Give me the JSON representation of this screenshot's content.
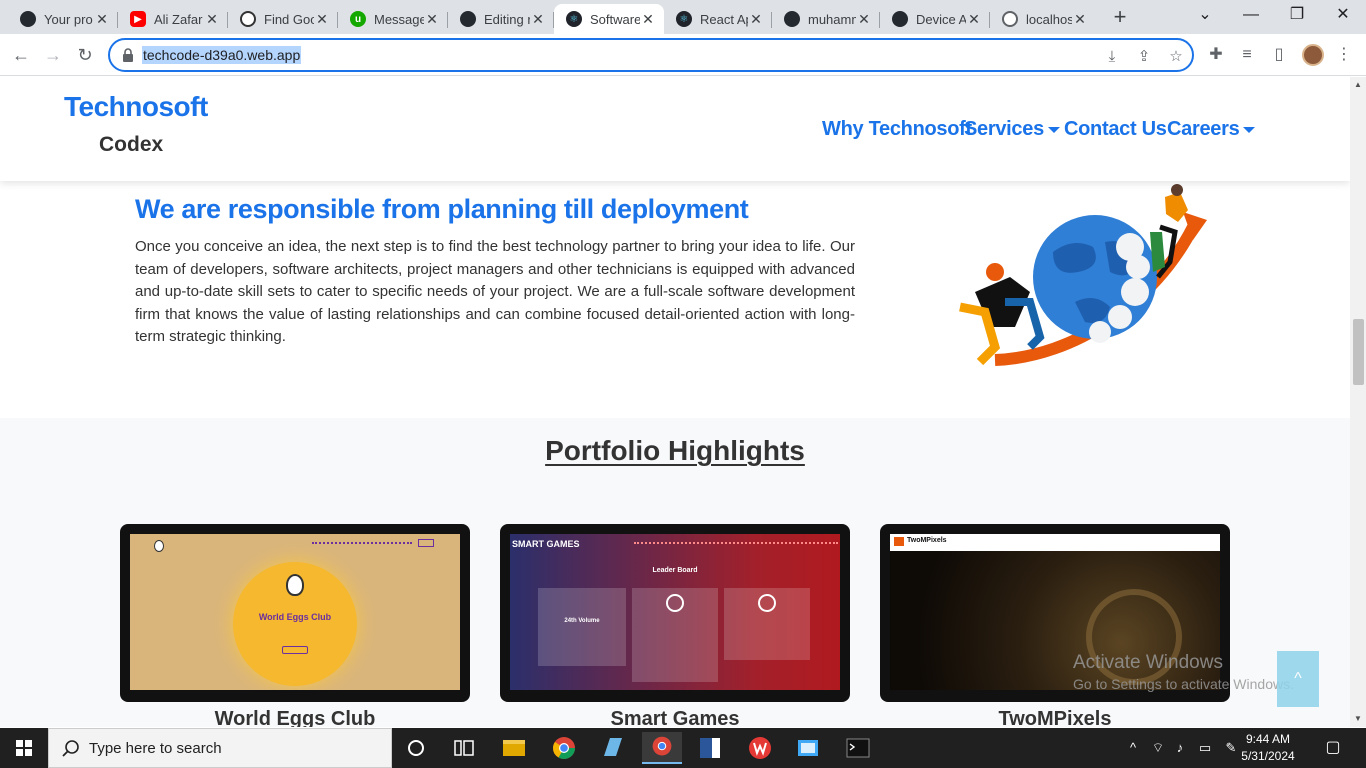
{
  "browser": {
    "tabs": [
      {
        "title": "Your pro",
        "icon": "github-icon"
      },
      {
        "title": "Ali Zafar",
        "icon": "youtube-icon"
      },
      {
        "title": "Find Goo",
        "icon": "openai-icon"
      },
      {
        "title": "Message",
        "icon": "upwork-icon"
      },
      {
        "title": "Editing r",
        "icon": "github-icon"
      },
      {
        "title": "Software",
        "icon": "react-icon"
      },
      {
        "title": "React Ap",
        "icon": "react-icon"
      },
      {
        "title": "muhamm",
        "icon": "github-icon"
      },
      {
        "title": "Device A",
        "icon": "github-icon"
      },
      {
        "title": "localhos",
        "icon": "globe-icon"
      }
    ],
    "url": "techcode-d39a0.web.app"
  },
  "site": {
    "logo_line1": "Technosoft",
    "logo_line2": "Codex",
    "nav": {
      "why": "Why Technosoft",
      "services": "Services",
      "contact": "Contact Us",
      "careers": "Careers"
    },
    "hero": {
      "title": "We are responsible from planning till deployment",
      "body": "Once you conceive an idea, the next step is to find the best technology partner to bring your idea to life. Our team of developers, software architects, project managers and other technicians is equipped with advanced and up-to-date skill sets to cater to specific needs of your project. We are a full-scale software development firm that knows the value of lasting relationships and can combine focused detail-oriented action with long-term strategic thinking."
    },
    "portfolio": {
      "title": "Portfolio Highlights",
      "items": [
        {
          "name": "World Eggs Club",
          "preview_heading": "World Eggs Club"
        },
        {
          "name": "Smart Games",
          "preview_heading": "SMART GAMES",
          "preview_sub": "Leader Board",
          "preview_stat": "24th Volume"
        },
        {
          "name": "TwoMPixels",
          "preview_heading": "TwoMPixels"
        }
      ]
    },
    "back_to_top": "^"
  },
  "watermark": {
    "line1": "Activate Windows",
    "line2": "Go to Settings to activate Windows."
  },
  "taskbar": {
    "search_placeholder": "Type here to search",
    "time": "9:44 AM",
    "date": "5/31/2024"
  },
  "colors": {
    "brand": "#1a73e8",
    "taskbar": "#202020"
  }
}
